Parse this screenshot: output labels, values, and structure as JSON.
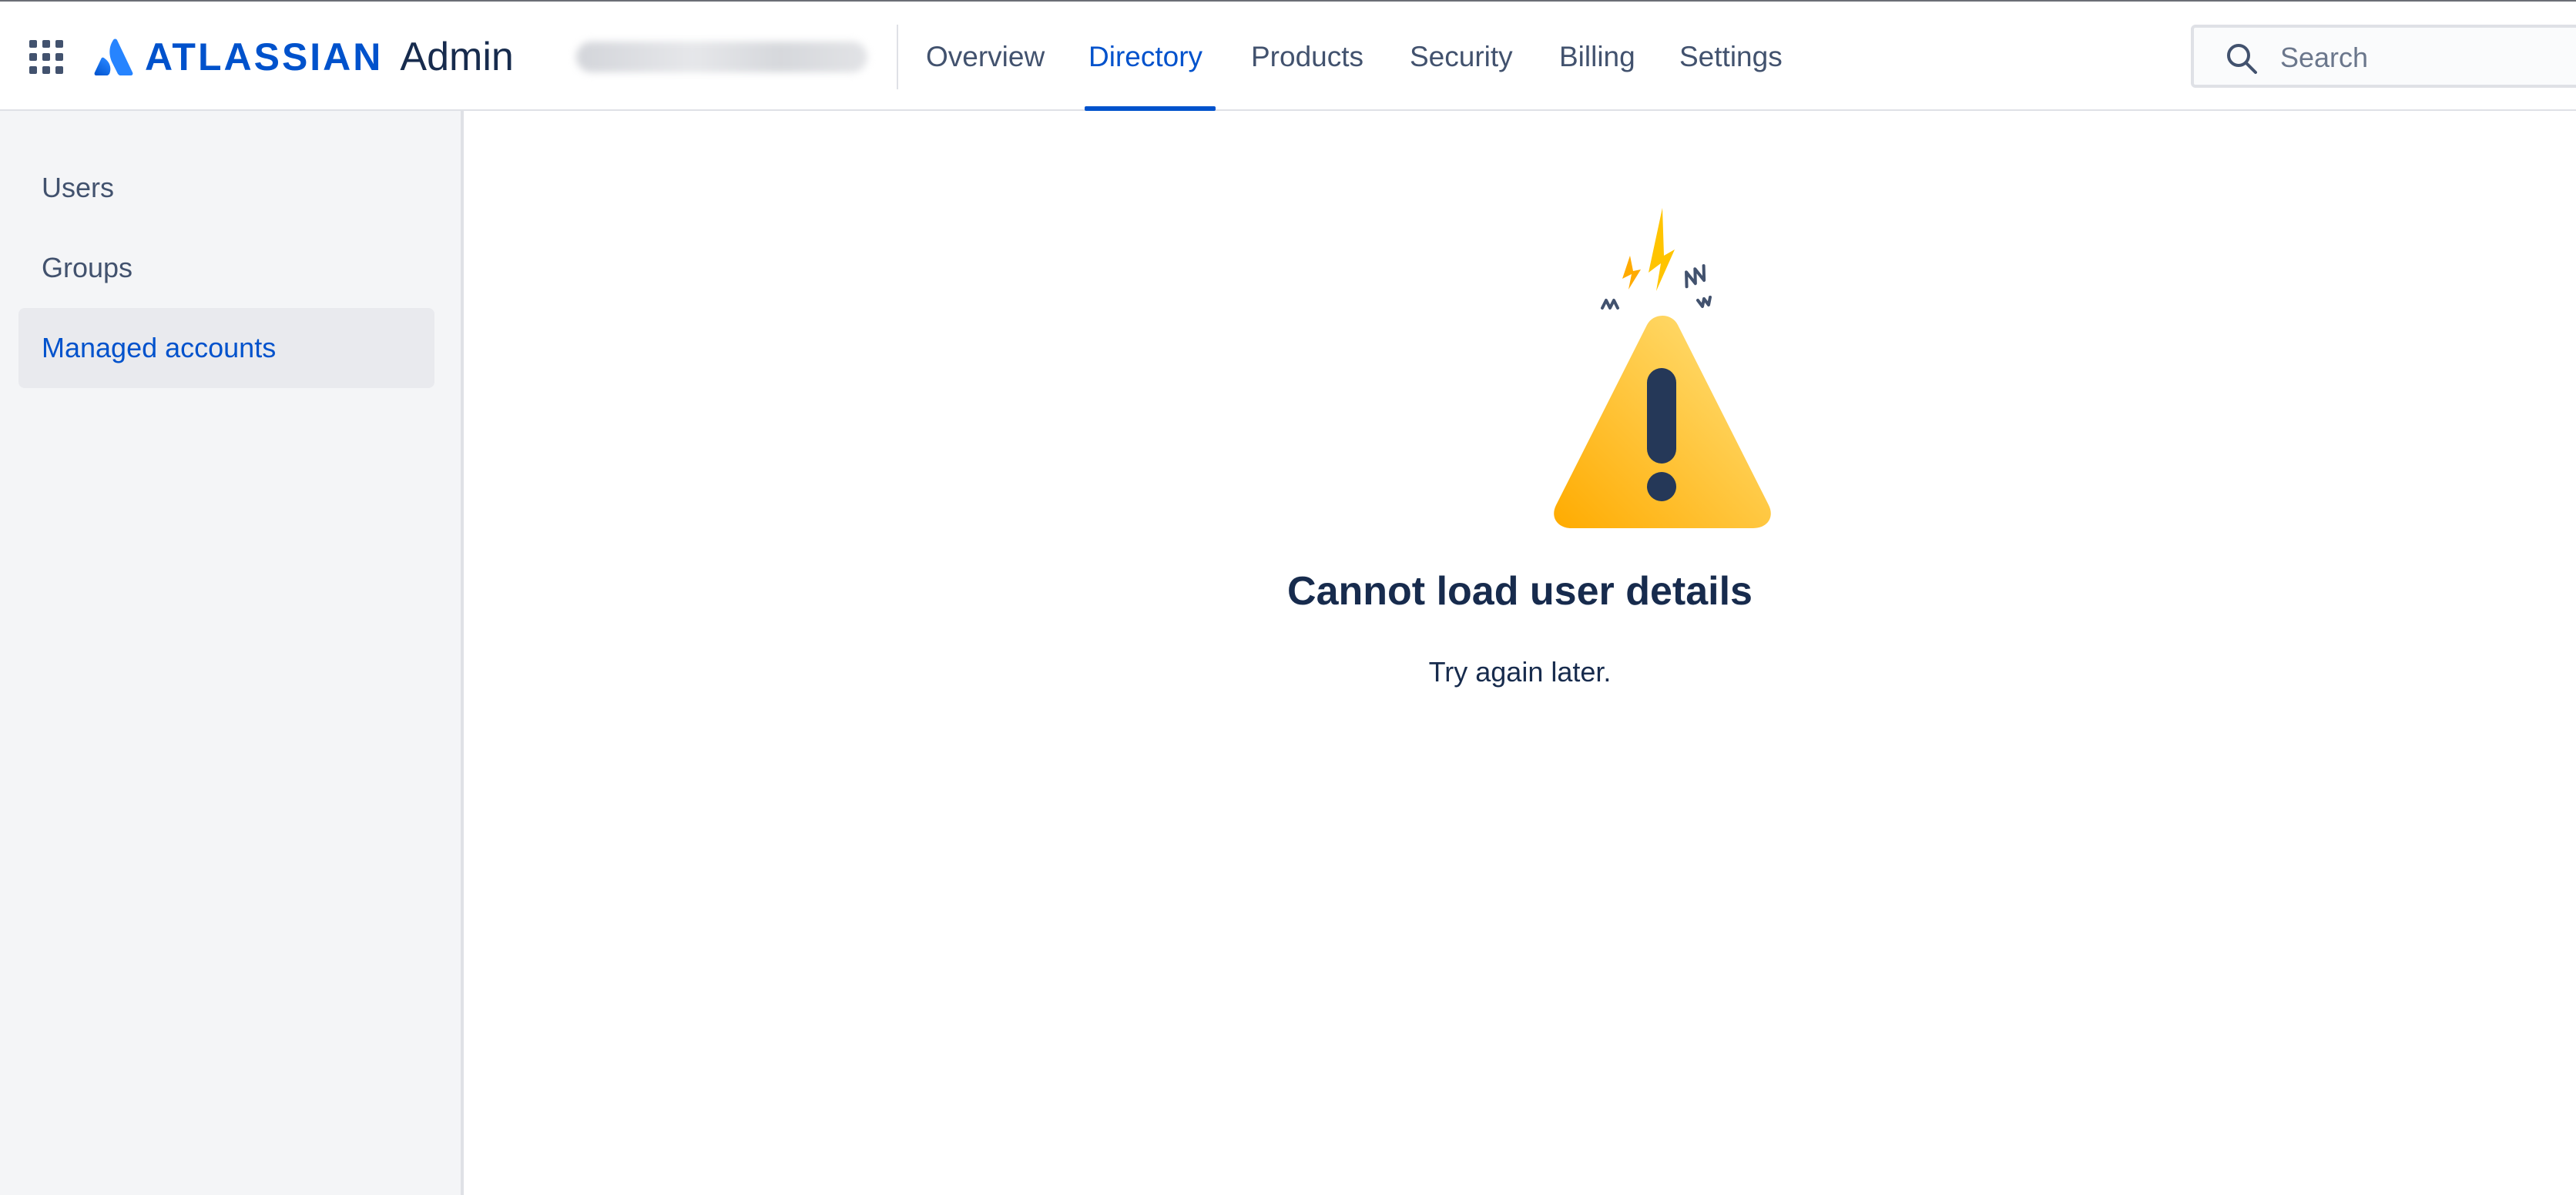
{
  "header": {
    "brand": "ATLASSIAN",
    "product": "Admin",
    "app_switcher_icon": "grid-icon",
    "nav": [
      {
        "label": "Overview",
        "active": false
      },
      {
        "label": "Directory",
        "active": true
      },
      {
        "label": "Products",
        "active": false
      },
      {
        "label": "Security",
        "active": false
      },
      {
        "label": "Billing",
        "active": false
      },
      {
        "label": "Settings",
        "active": false
      }
    ],
    "search": {
      "placeholder": "Search",
      "value": "",
      "icon": "search-icon"
    }
  },
  "sidebar": {
    "items": [
      {
        "label": "Users",
        "active": false
      },
      {
        "label": "Groups",
        "active": false
      },
      {
        "label": "Managed accounts",
        "active": true
      }
    ]
  },
  "main": {
    "illustration_icon": "warning-triangle-icon",
    "title": "Cannot load user details",
    "subtitle": "Try again later."
  },
  "colors": {
    "brand_blue": "#0052cc",
    "text_dark": "#172b4d",
    "text_muted": "#42526e",
    "warning_yellow": "#ffc400",
    "sidebar_bg": "#f4f5f7"
  }
}
